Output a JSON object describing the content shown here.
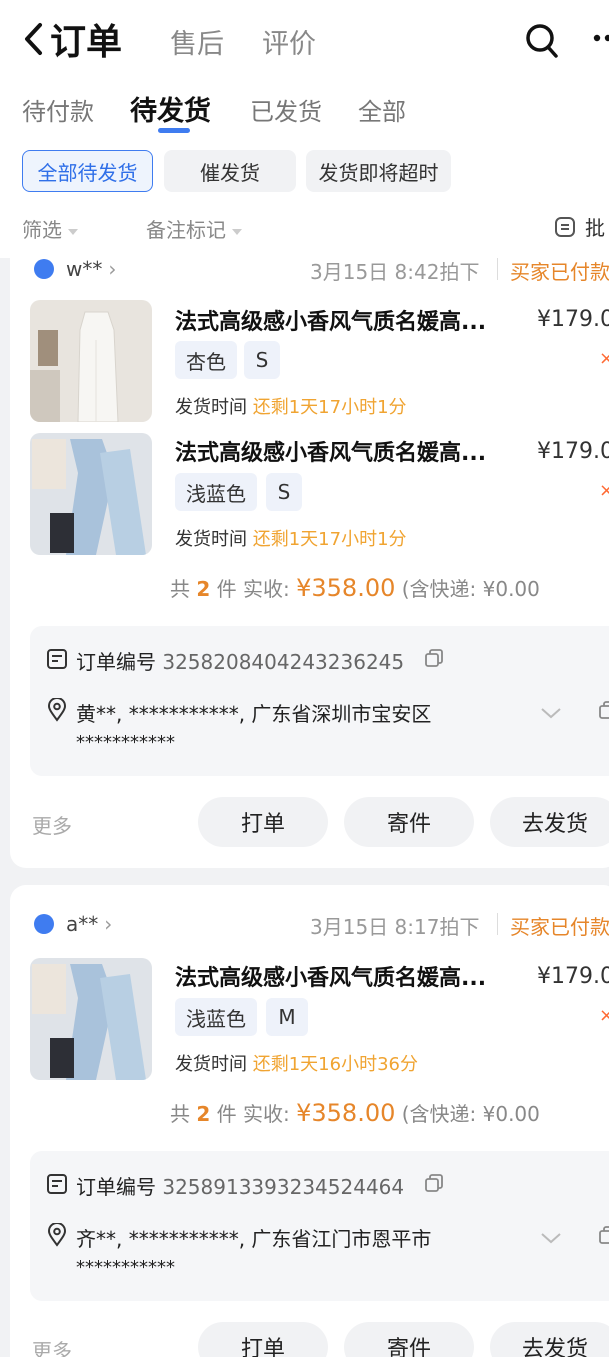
{
  "nav": {
    "back_label": "订单",
    "tabs": [
      "售后",
      "评价"
    ]
  },
  "status_tabs": [
    "待付款",
    "待发货",
    "已发货",
    "全部"
  ],
  "chips": [
    "全部待发货",
    "催发货",
    "发货即将超时"
  ],
  "filters": {
    "filter_label": "筛选",
    "remark_label": "备注标记",
    "batch_label": "批"
  },
  "orders": [
    {
      "buyer": "w**",
      "time": "3月15日 8:42拍下",
      "status": "买家已付款",
      "items": [
        {
          "title": "法式高级感小香风气质名媛高...",
          "price": "¥179.0",
          "qty": "×",
          "color": "杏色",
          "size": "S",
          "ship_label": "发货时间",
          "ship_remain": "还剩1天17小时1分"
        },
        {
          "title": "法式高级感小香风气质名媛高...",
          "price": "¥179.0",
          "qty": "×",
          "color": "浅蓝色",
          "size": "S",
          "ship_label": "发货时间",
          "ship_remain": "还剩1天17小时1分"
        }
      ],
      "summary": {
        "count_prefix": "共",
        "count": "2",
        "count_suffix": "件",
        "received_label": "实收:",
        "amount": "¥358.00",
        "shipping": "(含快递: ¥0.00"
      },
      "order_no_label": "订单编号",
      "order_no": "3258208404243236245",
      "address": "黄**, ***********, 广东省深圳市宝安区",
      "address_masked": "***********",
      "more_label": "更多",
      "buttons": [
        "打单",
        "寄件",
        "去发货"
      ]
    },
    {
      "buyer": "a**",
      "time": "3月15日 8:17拍下",
      "status": "买家已付款",
      "items": [
        {
          "title": "法式高级感小香风气质名媛高...",
          "price": "¥179.0",
          "qty": "×",
          "color": "浅蓝色",
          "size": "M",
          "ship_label": "发货时间",
          "ship_remain": "还剩1天16小时36分"
        }
      ],
      "summary": {
        "count_prefix": "共",
        "count": "2",
        "count_suffix": "件",
        "received_label": "实收:",
        "amount": "¥358.00",
        "shipping": "(含快递: ¥0.00"
      },
      "order_no_label": "订单编号",
      "order_no": "3258913393234524464",
      "address": "齐**, ***********, 广东省江门市恩平市",
      "address_masked": "***********",
      "more_label": "更多",
      "buttons": [
        "打单",
        "寄件",
        "去发货"
      ]
    }
  ],
  "colors": {
    "accent": "#3f7cf0",
    "warning": "#e6862a",
    "remain": "#f0a432"
  }
}
